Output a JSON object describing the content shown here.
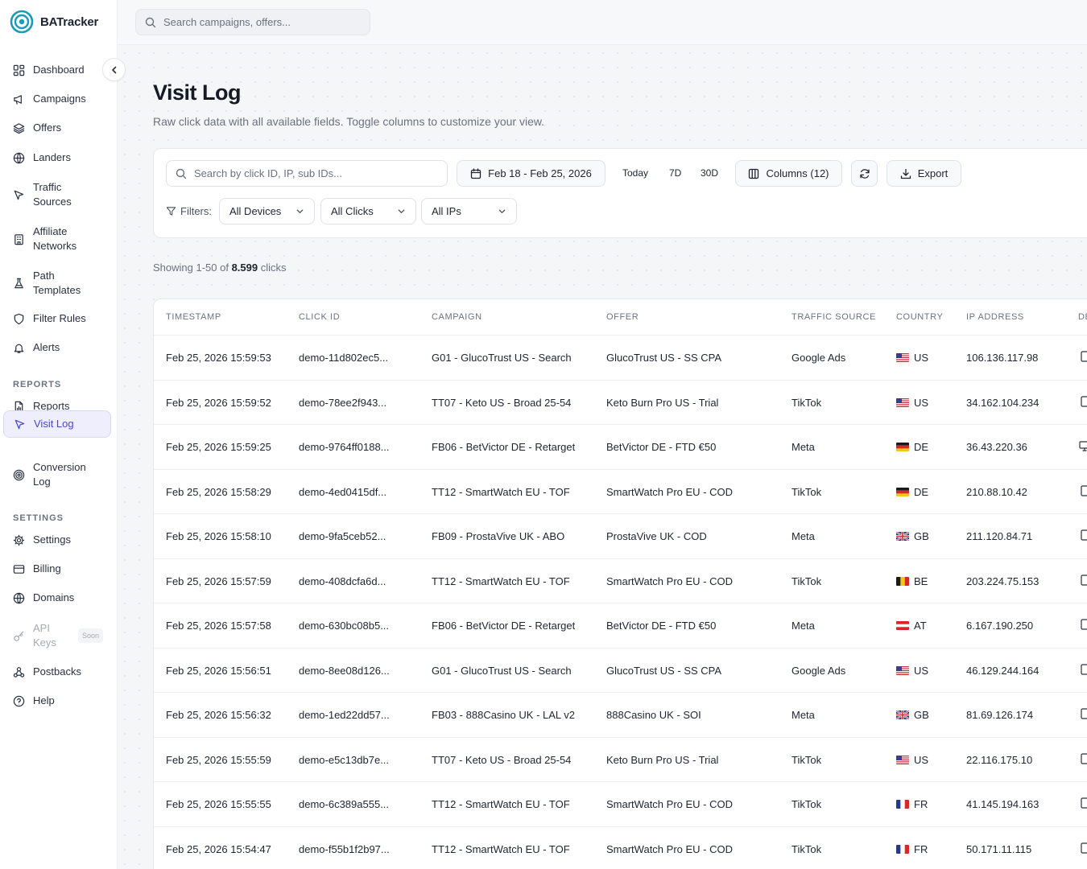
{
  "brand": {
    "name": "BATracker"
  },
  "topbar": {
    "search_placeholder": "Search campaigns, offers..."
  },
  "sidebar": {
    "items": [
      {
        "label": "Dashboard",
        "icon": "dashboard-icon"
      },
      {
        "label": "Campaigns",
        "icon": "megaphone-icon"
      },
      {
        "label": "Offers",
        "icon": "layers-icon"
      },
      {
        "label": "Landers",
        "icon": "globe-icon"
      },
      {
        "label": "Traffic\nSources",
        "icon": "cursor-icon"
      },
      {
        "label": "Affiliate\nNetworks",
        "icon": "building-icon"
      },
      {
        "label": "Path\nTemplates",
        "icon": "flask-icon"
      },
      {
        "label": "Filter Rules",
        "icon": "shield-icon"
      },
      {
        "label": "Alerts",
        "icon": "bell-icon"
      }
    ],
    "reports_label": "REPORTS",
    "reports_items": [
      {
        "label": "Reports",
        "icon": "file-chart-icon"
      },
      {
        "label": "Visit Log",
        "icon": "cursor-icon",
        "active": true
      },
      {
        "label": "Conversion\nLog",
        "icon": "target-icon"
      }
    ],
    "settings_label": "SETTINGS",
    "settings_items": [
      {
        "label": "Settings",
        "icon": "gear-icon"
      },
      {
        "label": "Billing",
        "icon": "credit-card-icon"
      },
      {
        "label": "Domains",
        "icon": "globe-icon"
      },
      {
        "label": "API\nKeys",
        "icon": "key-icon",
        "disabled": true,
        "badge": "Soon"
      },
      {
        "label": "Postbacks",
        "icon": "webhook-icon"
      },
      {
        "label": "Help",
        "icon": "help-icon"
      }
    ]
  },
  "page": {
    "title": "Visit Log",
    "subtitle": "Raw click data with all available fields. Toggle columns to customize your view."
  },
  "toolbar": {
    "search_placeholder": "Search by click ID, IP, sub IDs...",
    "date_range": "Feb 18 - Feb 25, 2026",
    "range_today": "Today",
    "range_7d": "7D",
    "range_30d": "30D",
    "columns_label": "Columns (12)",
    "export_label": "Export",
    "filters_label": "Filters:",
    "filter_devices": "All Devices",
    "filter_clicks": "All Clicks",
    "filter_ips": "All IPs"
  },
  "showing": {
    "prefix": "Showing 1-50 of",
    "count": "8.599",
    "suffix": "clicks"
  },
  "table": {
    "headers": [
      "TIMESTAMP",
      "CLICK ID",
      "CAMPAIGN",
      "OFFER",
      "TRAFFIC SOURCE",
      "COUNTRY",
      "IP ADDRESS",
      "DE"
    ],
    "rows": [
      {
        "timestamp": "Feb 25, 2026 15:59:53",
        "click_id": "demo-11d802ec5...",
        "campaign": "G01 - GlucoTrust US - Search",
        "offer": "GlucoTrust US - SS CPA",
        "source": "Google Ads",
        "country": "US",
        "ip": "106.136.117.98",
        "device": "mobile"
      },
      {
        "timestamp": "Feb 25, 2026 15:59:52",
        "click_id": "demo-78ee2f943...",
        "campaign": "TT07 - Keto US - Broad 25-54",
        "offer": "Keto Burn Pro US - Trial",
        "source": "TikTok",
        "country": "US",
        "ip": "34.162.104.234",
        "device": "mobile"
      },
      {
        "timestamp": "Feb 25, 2026 15:59:25",
        "click_id": "demo-9764ff0188...",
        "campaign": "FB06 - BetVictor DE - Retarget",
        "offer": "BetVictor DE - FTD €50",
        "source": "Meta",
        "country": "DE",
        "ip": "36.43.220.36",
        "device": "desktop"
      },
      {
        "timestamp": "Feb 25, 2026 15:58:29",
        "click_id": "demo-4ed0415df...",
        "campaign": "TT12 - SmartWatch EU - TOF",
        "offer": "SmartWatch Pro EU - COD",
        "source": "TikTok",
        "country": "DE",
        "ip": "210.88.10.42",
        "device": "mobile"
      },
      {
        "timestamp": "Feb 25, 2026 15:58:10",
        "click_id": "demo-9fa5ceb52...",
        "campaign": "FB09 - ProstaVive UK - ABO",
        "offer": "ProstaVive UK - COD",
        "source": "Meta",
        "country": "GB",
        "ip": "211.120.84.71",
        "device": "mobile"
      },
      {
        "timestamp": "Feb 25, 2026 15:57:59",
        "click_id": "demo-408dcfa6d...",
        "campaign": "TT12 - SmartWatch EU - TOF",
        "offer": "SmartWatch Pro EU - COD",
        "source": "TikTok",
        "country": "BE",
        "ip": "203.224.75.153",
        "device": "mobile"
      },
      {
        "timestamp": "Feb 25, 2026 15:57:58",
        "click_id": "demo-630bc08b5...",
        "campaign": "FB06 - BetVictor DE - Retarget",
        "offer": "BetVictor DE - FTD €50",
        "source": "Meta",
        "country": "AT",
        "ip": "6.167.190.250",
        "device": "mobile"
      },
      {
        "timestamp": "Feb 25, 2026 15:56:51",
        "click_id": "demo-8ee08d126...",
        "campaign": "G01 - GlucoTrust US - Search",
        "offer": "GlucoTrust US - SS CPA",
        "source": "Google Ads",
        "country": "US",
        "ip": "46.129.244.164",
        "device": "mobile"
      },
      {
        "timestamp": "Feb 25, 2026 15:56:32",
        "click_id": "demo-1ed22dd57...",
        "campaign": "FB03 - 888Casino UK - LAL v2",
        "offer": "888Casino UK - SOI",
        "source": "Meta",
        "country": "GB",
        "ip": "81.69.126.174",
        "device": "mobile"
      },
      {
        "timestamp": "Feb 25, 2026 15:55:59",
        "click_id": "demo-e5c13db7e...",
        "campaign": "TT07 - Keto US - Broad 25-54",
        "offer": "Keto Burn Pro US - Trial",
        "source": "TikTok",
        "country": "US",
        "ip": "22.116.175.10",
        "device": "mobile"
      },
      {
        "timestamp": "Feb 25, 2026 15:55:55",
        "click_id": "demo-6c389a555...",
        "campaign": "TT12 - SmartWatch EU - TOF",
        "offer": "SmartWatch Pro EU - COD",
        "source": "TikTok",
        "country": "FR",
        "ip": "41.145.194.163",
        "device": "mobile"
      },
      {
        "timestamp": "Feb 25, 2026 15:54:47",
        "click_id": "demo-f55b1f2b97...",
        "campaign": "TT12 - SmartWatch EU - TOF",
        "offer": "SmartWatch Pro EU - COD",
        "source": "TikTok",
        "country": "FR",
        "ip": "50.171.11.115",
        "device": "mobile"
      }
    ]
  },
  "colors": {
    "accent": "#4b46c8",
    "brand": "#1a9bb8",
    "active_bg": "#eeeefc"
  }
}
